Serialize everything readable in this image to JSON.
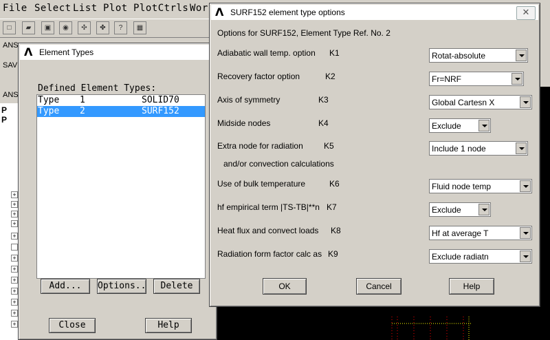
{
  "app": {
    "menu": [
      "File",
      "Select",
      "List",
      "Plot",
      "PlotCtrls",
      "Work"
    ],
    "toolbar_label_ans": "ANS",
    "toolbar_label_sav": "SAV",
    "tree_prefix_p": "P"
  },
  "element_types": {
    "title": "Element Types",
    "heading": "Defined Element Types:",
    "rows": [
      {
        "type": "Type",
        "num": "1",
        "name": "SOLID70"
      },
      {
        "type": "Type",
        "num": "2",
        "name": "SURF152"
      }
    ],
    "buttons": {
      "add": "Add...",
      "options": "Options...",
      "delete": "Delete",
      "close": "Close",
      "help": "Help"
    }
  },
  "surf_dialog": {
    "title": "SURF152 element type options",
    "subtitle": "Options for SURF152, Element Type Ref. No. 2",
    "options": [
      {
        "label": "Adiabatic wall temp. option",
        "key": "K1",
        "value": "Rotat-absolute"
      },
      {
        "label": "Recovery factor option",
        "key": "K2",
        "value": "Fr=NRF"
      },
      {
        "label": "Axis of symmetry",
        "key": "K3",
        "value": "Global Cartesn X"
      },
      {
        "label": "Midside nodes",
        "key": "K4",
        "value": "Exclude"
      },
      {
        "label": "Extra node for radiation",
        "label2": "and/or convection calculations",
        "key": "K5",
        "value": "Include 1 node"
      },
      {
        "label": "Use of bulk temperature",
        "key": "K6",
        "value": "Fluid node temp"
      },
      {
        "label": "hf empirical term |TS-TB|**n",
        "key": "K7",
        "value": "Exclude"
      },
      {
        "label": "Heat flux and convect loads",
        "key": "K8",
        "value": "Hf at average T"
      },
      {
        "label": "Radiation form factor calc as",
        "key": "K9",
        "value": "Exclude radiatn"
      }
    ],
    "buttons": {
      "ok": "OK",
      "cancel": "Cancel",
      "help": "Help"
    }
  },
  "colors": {
    "selection": "#3399ff",
    "dialog_bg": "#d4d0c8"
  }
}
